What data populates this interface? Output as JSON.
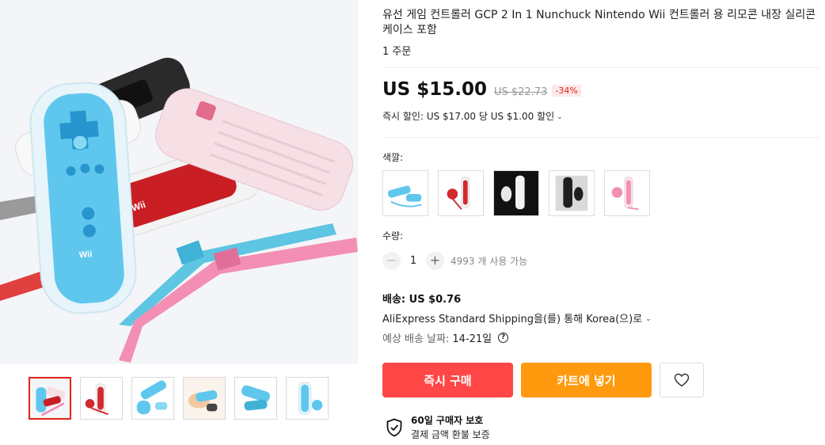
{
  "product": {
    "title": "유선 게임 컨트롤러 GCP 2 In 1 Nunchuck Nintendo Wii 컨트롤러 용 리모콘 내장 실리콘 케이스 포함",
    "orders": "1 주문"
  },
  "gallery": {
    "main_image": "wii-remote-silicone-case-photo",
    "thumbnails": [
      "thumb-1",
      "thumb-2",
      "thumb-3",
      "thumb-4",
      "thumb-5",
      "thumb-6"
    ],
    "active_index": 0
  },
  "price": {
    "current": "US $15.00",
    "original": "US $22.73",
    "discount": "-34%",
    "promo": "즉시 할인: US $17.00 당 US $1.00 할인"
  },
  "color": {
    "label": "색깔:",
    "options": [
      "blue",
      "red",
      "white",
      "black",
      "pink"
    ]
  },
  "quantity": {
    "label": "수량:",
    "minus": "−",
    "value": "1",
    "plus": "+",
    "available": "4993 개 사용 가능"
  },
  "shipping": {
    "title": "배송: US $0.76",
    "method": "AliExpress Standard Shipping을(를) 통해 Korea(으)로",
    "eta_label": "예상 배송 날짜:",
    "eta_value": "14-21일"
  },
  "actions": {
    "buy_now": "즉시 구매",
    "add_to_cart": "카트에 넣기"
  },
  "guarantee": {
    "title": "60일 구매자 보호",
    "subtitle": "결제 금액 환불 보증"
  },
  "colors": {
    "buy": "#ff4747",
    "cart": "#ff9a0e",
    "accent_red": "#e2231a",
    "remote_blue": "#58c6ef",
    "strap_pink": "#f28fb3"
  }
}
